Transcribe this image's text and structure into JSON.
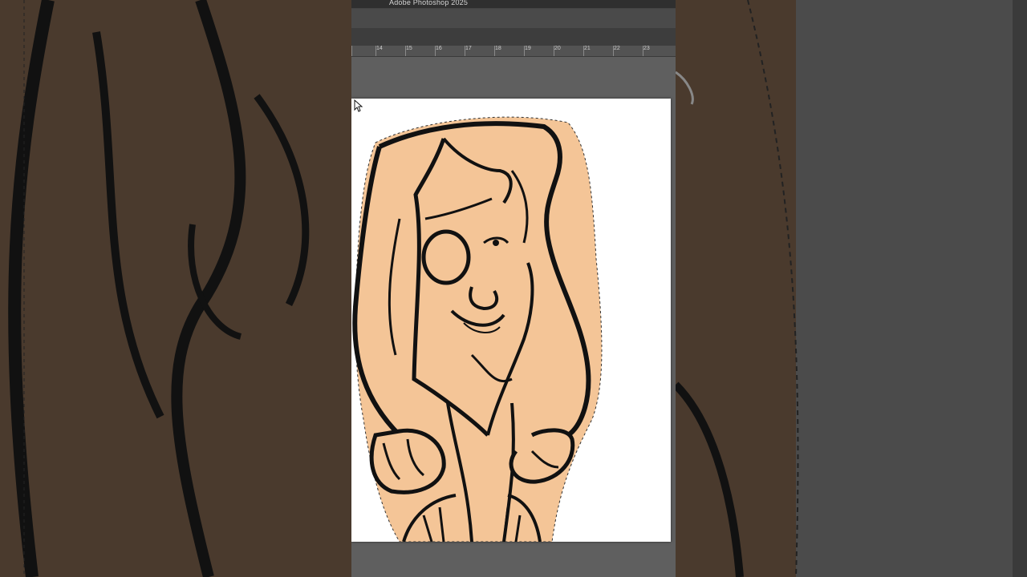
{
  "app": {
    "title": "Adobe Photoshop 2025"
  },
  "ruler": {
    "ticks": [
      "14",
      "15",
      "16",
      "17",
      "18",
      "19",
      "20",
      "21",
      "22",
      "23"
    ]
  },
  "colors": {
    "skin_fill": "#f4c597",
    "line_art": "#111111",
    "canvas_bg": "#ffffff",
    "workspace": "#5f5f5f",
    "titlebar": "#2f2f2f"
  },
  "icons": {
    "cursor": "hand-pointer-icon"
  }
}
